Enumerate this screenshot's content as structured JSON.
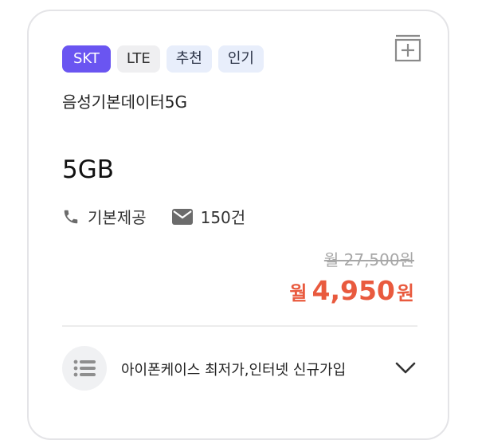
{
  "plan": {
    "tags": {
      "carrier": "SKT",
      "network": "LTE",
      "recommend": "추천",
      "popular": "인기"
    },
    "name": "음성기본데이터5G",
    "data": "5GB",
    "voice": "기본제공",
    "sms": "150건",
    "price": {
      "original": "월 27,500원",
      "prefix": "월",
      "amount": "4,950",
      "suffix": "원"
    },
    "benefit": "아이폰케이스 최저가,인터넷 신규가입"
  },
  "icons": {
    "compare": "add-to-compare-icon",
    "phone": "phone-icon",
    "sms": "envelope-icon",
    "benefits": "list-icon",
    "expand": "chevron-down-icon"
  },
  "colors": {
    "carrier_tag": "#6a55f1",
    "sale_price": "#e95a3e",
    "original_price": "#a7a7a7",
    "border": "#e4e4e7"
  }
}
